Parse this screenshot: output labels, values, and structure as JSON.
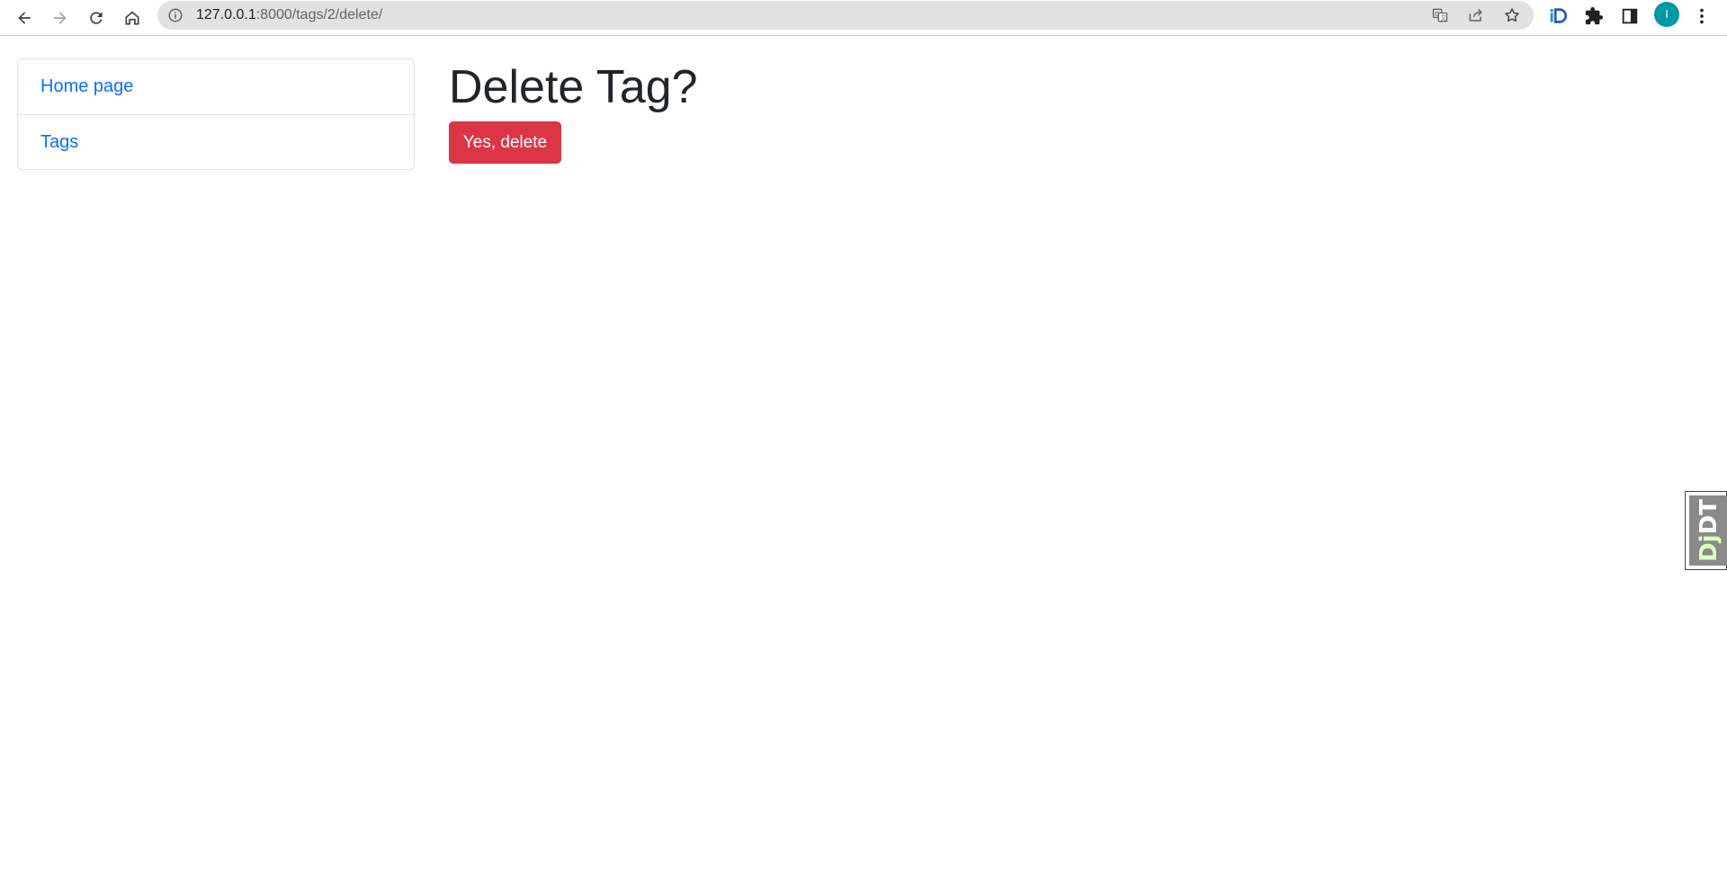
{
  "browser": {
    "url_host": "127.0.0.1",
    "url_rest": ":8000/tags/2/delete/",
    "profile_initial": "I",
    "icons": {
      "back": "back-arrow-icon",
      "forward": "forward-arrow-icon",
      "reload": "reload-icon",
      "home": "home-icon",
      "site_info": "info-circle-icon",
      "translate": "translate-icon",
      "share": "share-icon",
      "bookmark": "star-icon",
      "extension_id": "id-extension-icon",
      "extensions": "puzzle-icon",
      "side_panel": "side-panel-icon",
      "menu": "kebab-menu-icon"
    }
  },
  "sidebar": {
    "items": [
      {
        "label": "Home page"
      },
      {
        "label": "Tags"
      }
    ]
  },
  "main": {
    "title": "Delete Tag?",
    "delete_button_label": "Yes, delete"
  },
  "debug_toolbar": {
    "handle_dj": "Dj",
    "handle_dt": "DT"
  },
  "colors": {
    "link": "#0d6efd",
    "danger": "#dc3545",
    "heading": "#212529",
    "profile": "#0097a7"
  }
}
